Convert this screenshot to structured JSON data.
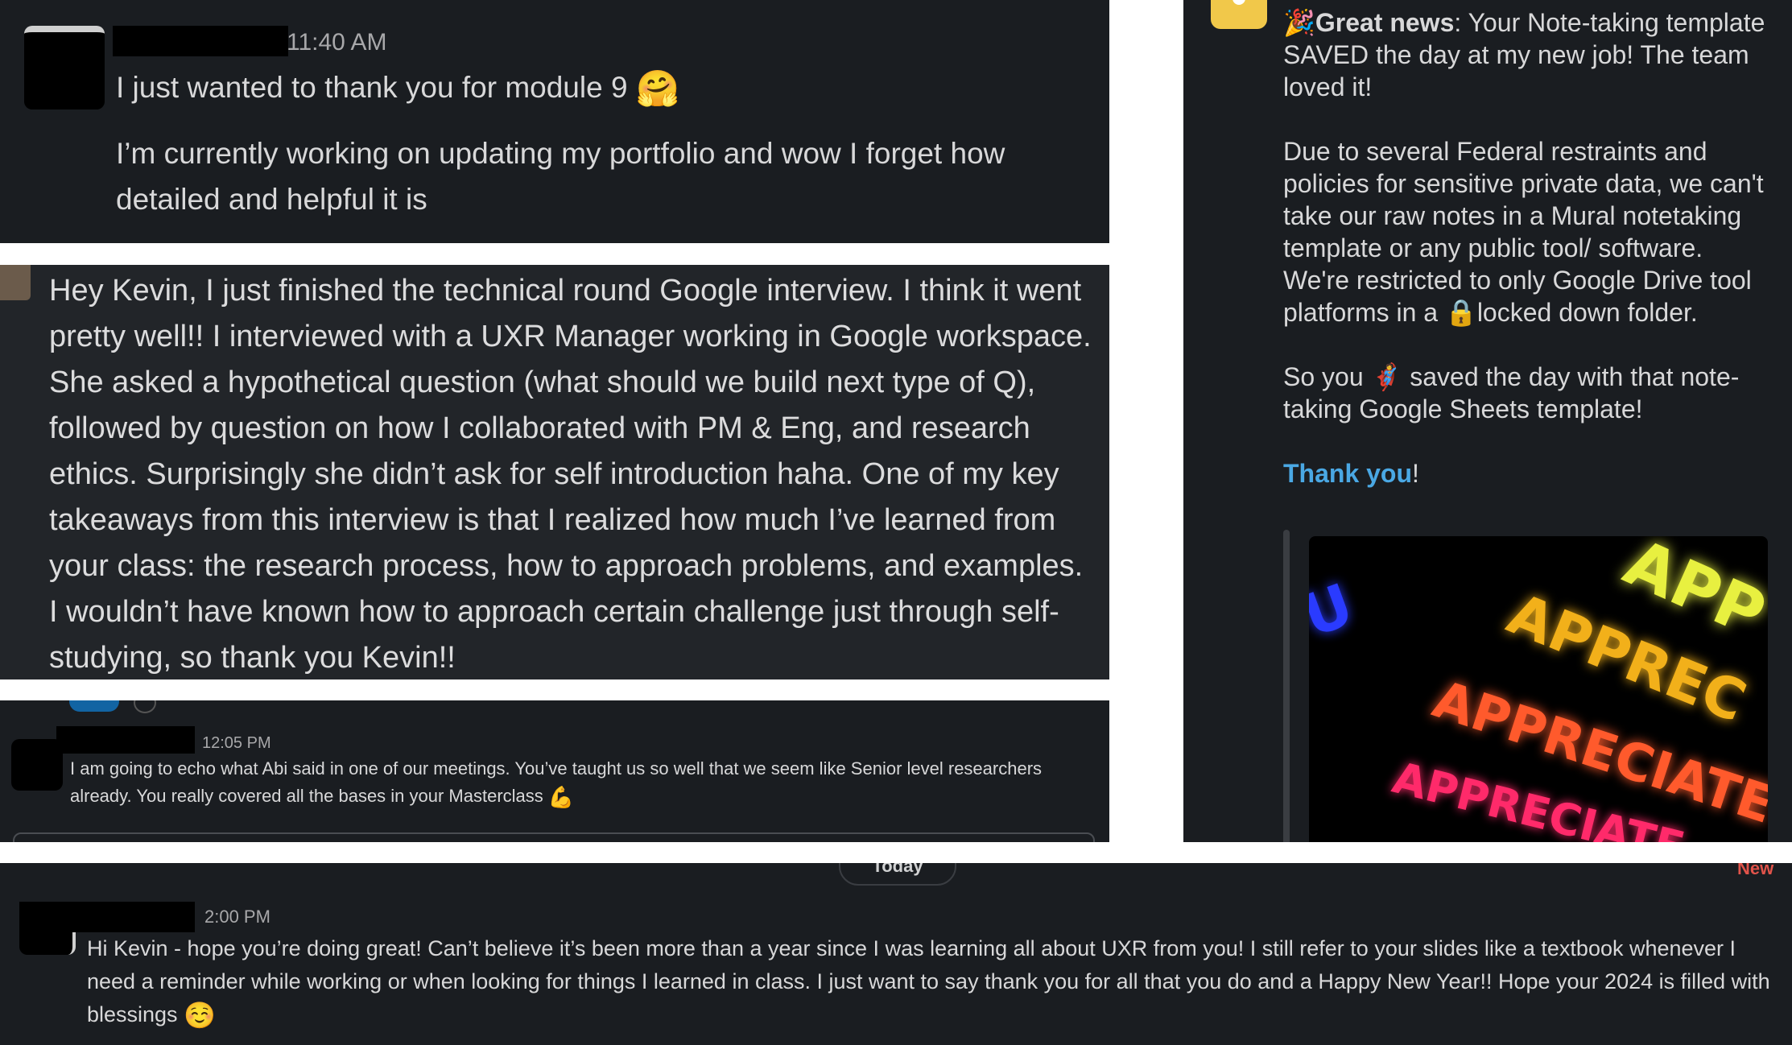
{
  "panel1": {
    "time": "11:40 AM",
    "line1": "I just wanted to thank you for module 9",
    "line1_emoji": "🤗",
    "line2": "I’m currently working on updating my portfolio and wow I forget how detailed and helpful it is"
  },
  "panel2": {
    "message": "Hey Kevin, I just finished the technical round Google interview. I think it went pretty well!! I interviewed with a UXR Manager working in Google workspace. She asked a hypothetical question (what should we build next type of Q), followed by question on how I collaborated with PM & Eng, and research ethics. Surprisingly she didn’t ask for self introduction haha. One of my key takeaways from this interview is that I realized how much I’ve learned from your class: the research process, how to approach problems, and examples. I wouldn’t have known how to approach certain challenge just through self-studying, so thank you Kevin!!"
  },
  "panel3": {
    "time": "12:05 PM",
    "message": "I am going to echo what Abi said in one of our meetings. You’ve taught us so well that we seem like Senior level researchers already. You really covered all the bases in your Masterclass",
    "emoji": "💪"
  },
  "panel4": {
    "party_emoji": "🎉",
    "great_news": "Great news",
    "intro_rest": ": Your Note-taking template SAVED the day at my new job! The team loved it!",
    "para2_a": "Due to several Federal restraints and policies for sensitive private data, we can't take our raw notes in a Mural notetaking template or any public tool/ software. We're restricted to only Google Drive tool platforms in a",
    "lock_emoji": "🔒",
    "para2_b": "locked down folder.",
    "para3_a": "So you",
    "hero_emoji": "🦸",
    "para3_b": "saved the day with that note-taking Google Sheets template!",
    "thank_you": "Thank you",
    "exclaim": "!",
    "gif_words": [
      "APP",
      "APPREC",
      "APPRECIATE",
      "APPRECIATE",
      "U"
    ]
  },
  "panel5": {
    "divider": "Today",
    "new_label": "New",
    "time": "2:00 PM",
    "message": "Hi Kevin - hope you’re doing great! Can’t believe it’s been more than a year since I was learning all about UXR from you! I still refer to your slides like a textbook whenever I need a reminder while working or when looking for things I learned in class. I just want to say thank you for all that you do and a Happy New Year!! Hope your 2024 is filled with blessings",
    "emoji": "☺️"
  },
  "colors": {
    "background": "#1a1d21",
    "link": "#4aa8e4",
    "new_badge": "#e0534a"
  }
}
